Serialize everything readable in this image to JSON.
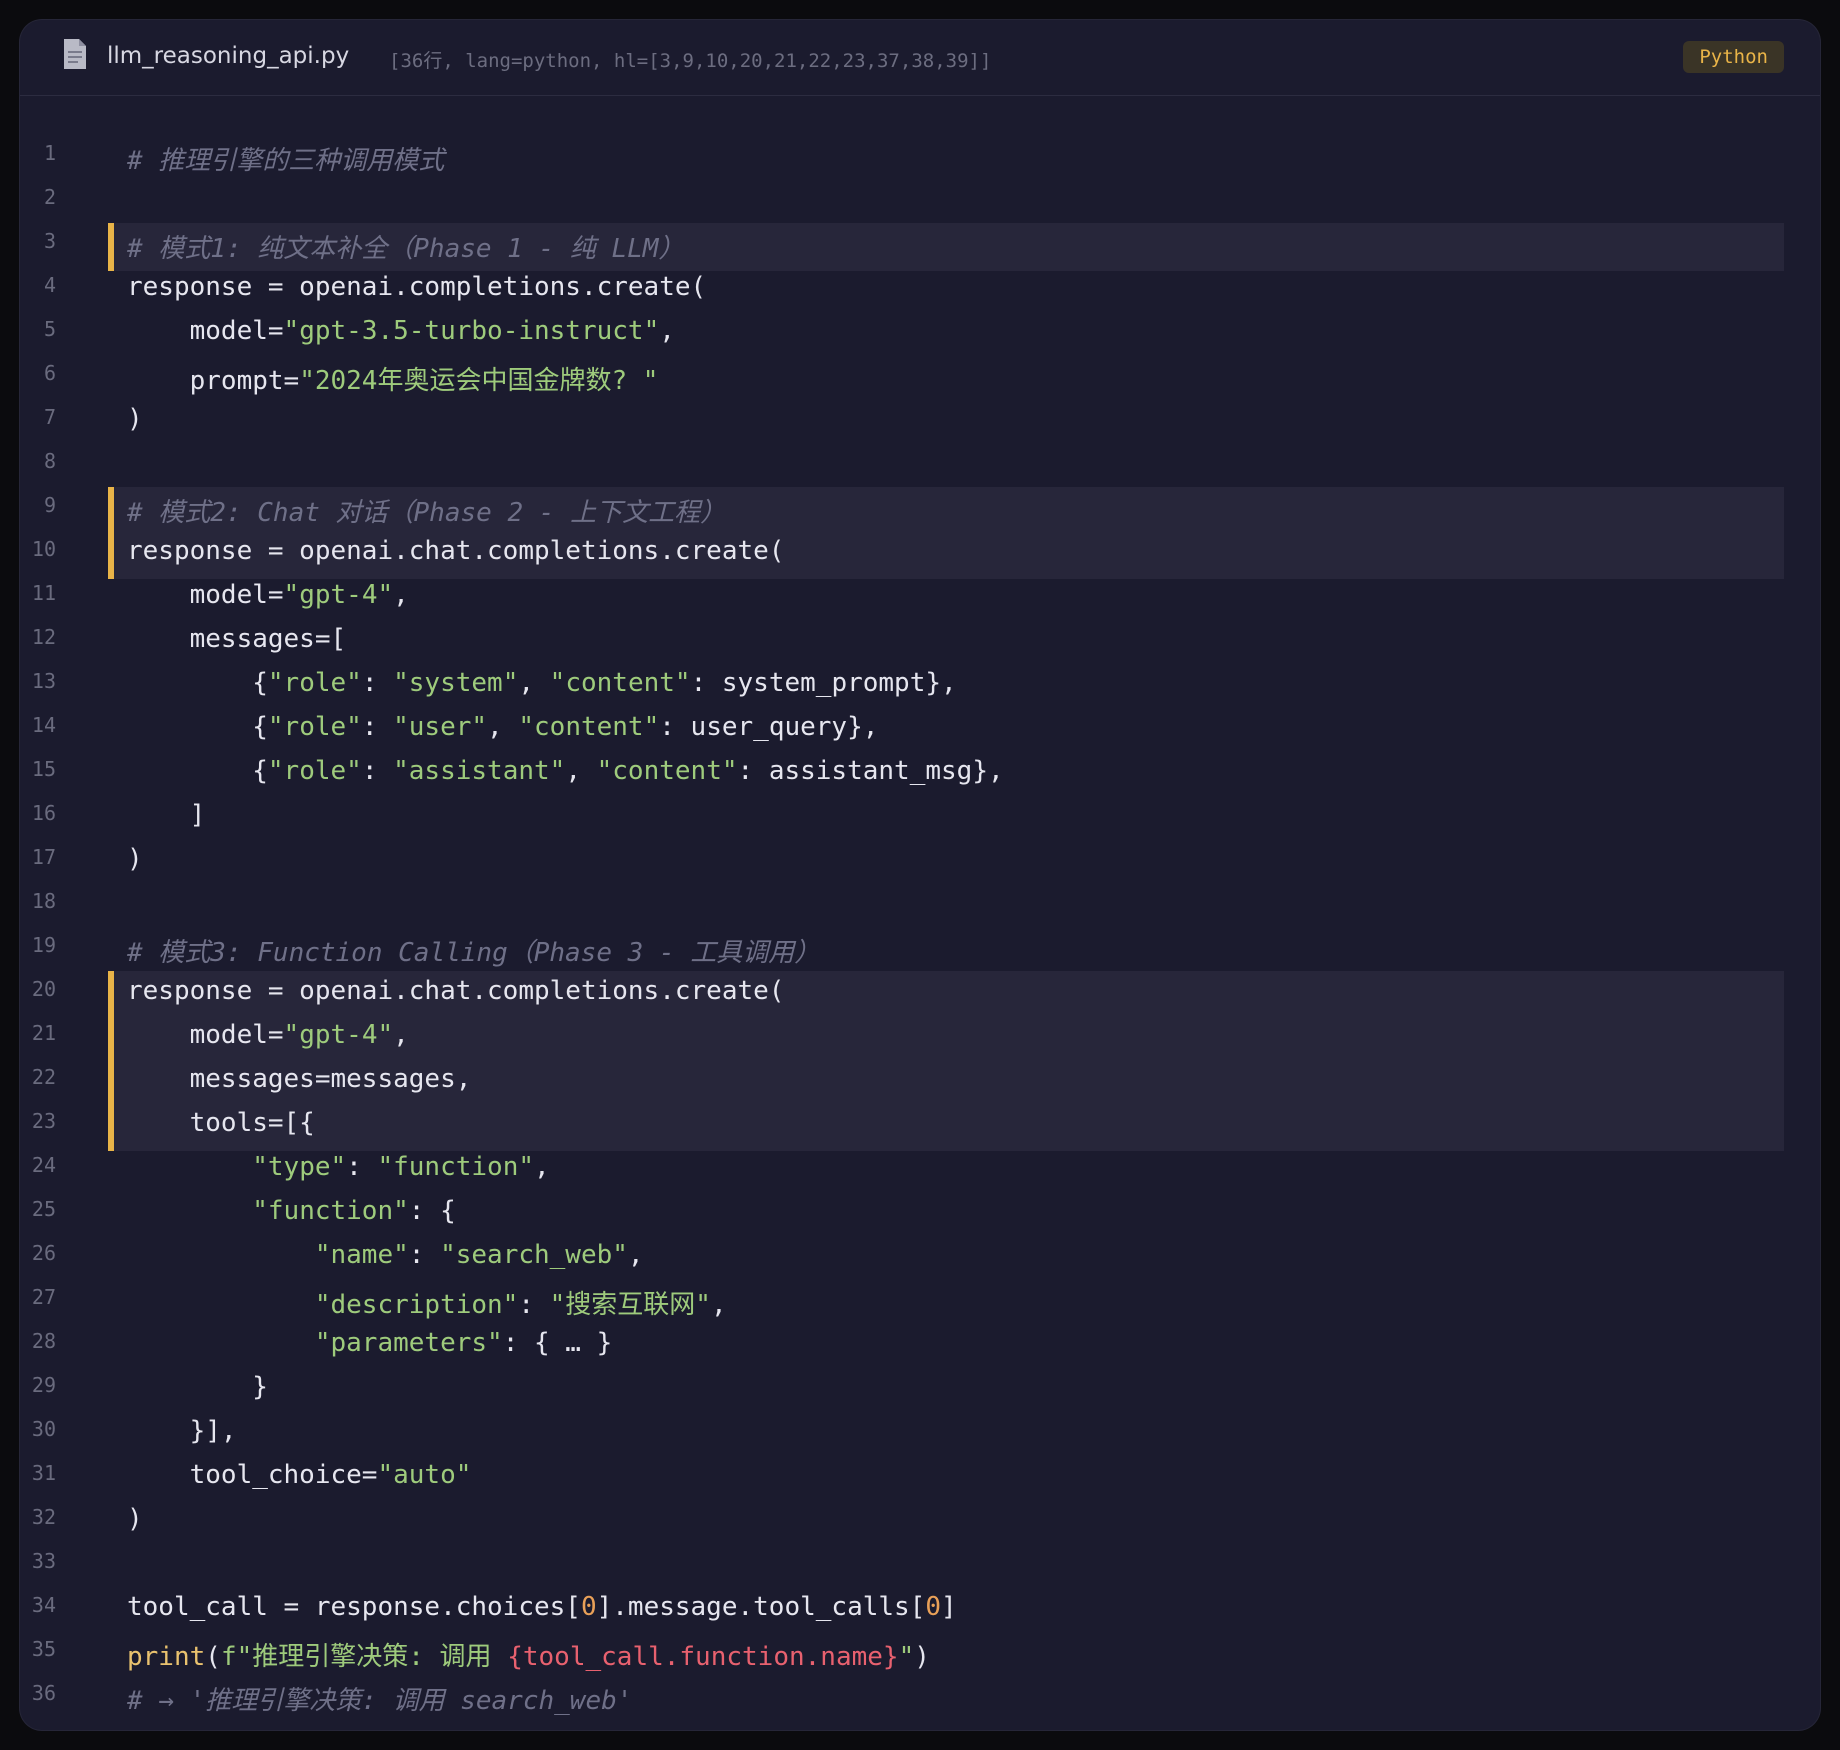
{
  "header": {
    "filename": "llm_reasoning_api.py",
    "meta": "[36行, lang=python, hl=[3,9,10,20,21,22,23,37,38,39]]",
    "language_badge": "Python",
    "icon": "file-icon"
  },
  "colors": {
    "background": "#1b1b2e",
    "highlight_bg": "#27263a",
    "highlight_bar": "#e9b448",
    "comment": "#6f7088",
    "string": "#9ecb7c",
    "number": "#e9a058",
    "builtin": "#e9c26f",
    "interpolation": "#e8616f",
    "text": "#e6e6ef"
  },
  "code": {
    "highlighted_lines": [
      3,
      9,
      10,
      20,
      21,
      22,
      23
    ],
    "lines": [
      [
        [
          "c",
          "# 推理引擎的三种调用模式"
        ]
      ],
      [],
      [
        [
          "c",
          "# 模式1: 纯文本补全（Phase 1 - 纯 LLM）"
        ]
      ],
      [
        [
          "p",
          "response = openai.completions.create("
        ]
      ],
      [
        [
          "p",
          "    model="
        ],
        [
          "s",
          "\"gpt-3.5-turbo-instruct\""
        ],
        [
          "p",
          ","
        ]
      ],
      [
        [
          "p",
          "    prompt="
        ],
        [
          "s",
          "\"2024年奥运会中国金牌数? \""
        ]
      ],
      [
        [
          "p",
          ")"
        ]
      ],
      [],
      [
        [
          "c",
          "# 模式2: Chat 对话（Phase 2 - 上下文工程）"
        ]
      ],
      [
        [
          "p",
          "response = openai.chat.completions.create("
        ]
      ],
      [
        [
          "p",
          "    model="
        ],
        [
          "s",
          "\"gpt-4\""
        ],
        [
          "p",
          ","
        ]
      ],
      [
        [
          "p",
          "    messages=["
        ]
      ],
      [
        [
          "p",
          "        {"
        ],
        [
          "s",
          "\"role\""
        ],
        [
          "p",
          ": "
        ],
        [
          "s",
          "\"system\""
        ],
        [
          "p",
          ", "
        ],
        [
          "s",
          "\"content\""
        ],
        [
          "p",
          ": system_prompt},"
        ]
      ],
      [
        [
          "p",
          "        {"
        ],
        [
          "s",
          "\"role\""
        ],
        [
          "p",
          ": "
        ],
        [
          "s",
          "\"user\""
        ],
        [
          "p",
          ", "
        ],
        [
          "s",
          "\"content\""
        ],
        [
          "p",
          ": user_query},"
        ]
      ],
      [
        [
          "p",
          "        {"
        ],
        [
          "s",
          "\"role\""
        ],
        [
          "p",
          ": "
        ],
        [
          "s",
          "\"assistant\""
        ],
        [
          "p",
          ", "
        ],
        [
          "s",
          "\"content\""
        ],
        [
          "p",
          ": assistant_msg},"
        ]
      ],
      [
        [
          "p",
          "    ]"
        ]
      ],
      [
        [
          "p",
          ")"
        ]
      ],
      [],
      [
        [
          "c",
          "# 模式3: Function Calling（Phase 3 - 工具调用）"
        ]
      ],
      [
        [
          "p",
          "response = openai.chat.completions.create("
        ]
      ],
      [
        [
          "p",
          "    model="
        ],
        [
          "s",
          "\"gpt-4\""
        ],
        [
          "p",
          ","
        ]
      ],
      [
        [
          "p",
          "    messages=messages,"
        ]
      ],
      [
        [
          "p",
          "    tools=[{"
        ]
      ],
      [
        [
          "p",
          "        "
        ],
        [
          "s",
          "\"type\""
        ],
        [
          "p",
          ": "
        ],
        [
          "s",
          "\"function\""
        ],
        [
          "p",
          ","
        ]
      ],
      [
        [
          "p",
          "        "
        ],
        [
          "s",
          "\"function\""
        ],
        [
          "p",
          ": {"
        ]
      ],
      [
        [
          "p",
          "            "
        ],
        [
          "s",
          "\"name\""
        ],
        [
          "p",
          ": "
        ],
        [
          "s",
          "\"search_web\""
        ],
        [
          "p",
          ","
        ]
      ],
      [
        [
          "p",
          "            "
        ],
        [
          "s",
          "\"description\""
        ],
        [
          "p",
          ": "
        ],
        [
          "s",
          "\"搜索互联网\""
        ],
        [
          "p",
          ","
        ]
      ],
      [
        [
          "p",
          "            "
        ],
        [
          "s",
          "\"parameters\""
        ],
        [
          "p",
          ": { … }"
        ]
      ],
      [
        [
          "p",
          "        }"
        ]
      ],
      [
        [
          "p",
          "    }],"
        ]
      ],
      [
        [
          "p",
          "    tool_choice="
        ],
        [
          "s",
          "\"auto\""
        ]
      ],
      [
        [
          "p",
          ")"
        ]
      ],
      [],
      [
        [
          "p",
          "tool_call = response.choices["
        ],
        [
          "n",
          "0"
        ],
        [
          "p",
          "].message.tool_calls["
        ],
        [
          "n",
          "0"
        ],
        [
          "p",
          "]"
        ]
      ],
      [
        [
          "b",
          "print"
        ],
        [
          "p",
          "("
        ],
        [
          "s",
          "f\"推理引擎决策: 调用 "
        ],
        [
          "i",
          "{tool_call.function.name}"
        ],
        [
          "s",
          "\""
        ],
        [
          "p",
          ")"
        ]
      ],
      [
        [
          "c",
          "# → '推理引擎决策: 调用 search_web'"
        ]
      ]
    ]
  }
}
